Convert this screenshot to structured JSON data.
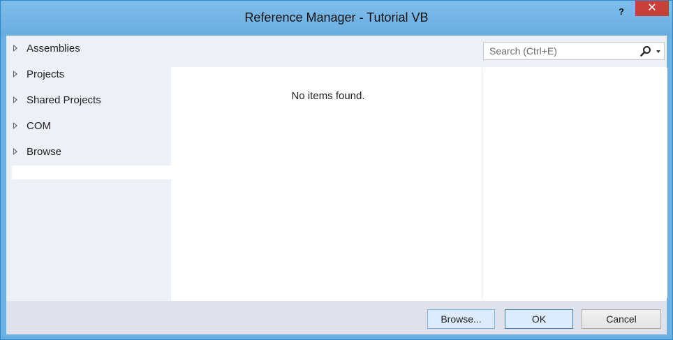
{
  "window": {
    "title": "Reference Manager - Tutorial VB",
    "help_label": "?",
    "close_label": "✕"
  },
  "sidebar": {
    "items": [
      {
        "label": "Assemblies"
      },
      {
        "label": "Projects"
      },
      {
        "label": "Shared Projects"
      },
      {
        "label": "COM"
      },
      {
        "label": "Browse"
      }
    ]
  },
  "search": {
    "placeholder": "Search (Ctrl+E)",
    "value": "",
    "icon": "search-icon"
  },
  "list": {
    "empty_message": "No items found."
  },
  "footer": {
    "browse_label": "Browse...",
    "ok_label": "OK",
    "cancel_label": "Cancel"
  },
  "colors": {
    "titlebar": "#6bb0e3",
    "close_button": "#c7413a",
    "sidebar_bg": "#eef0f7",
    "footer_bg": "#dfe2ea"
  }
}
